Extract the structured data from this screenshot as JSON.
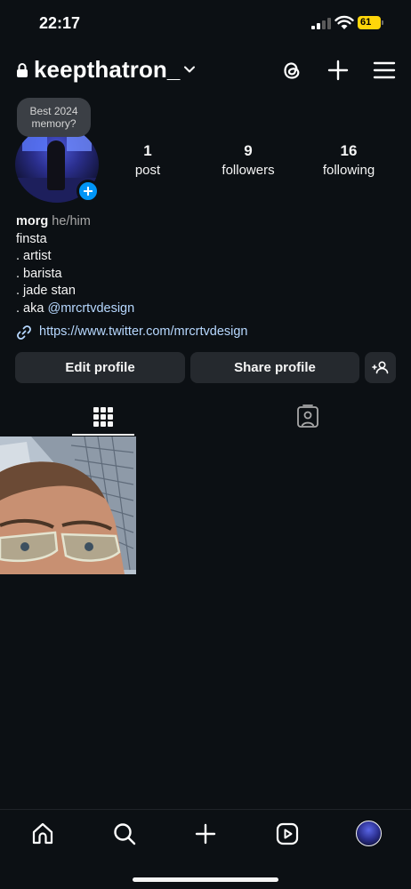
{
  "status_bar": {
    "time": "22:17",
    "battery_level": "61",
    "battery_color": "#ffd60a"
  },
  "header": {
    "username": "keepthatron_",
    "icons": [
      "lock-icon",
      "chevron-down-icon",
      "threads-icon",
      "plus-icon",
      "menu-icon"
    ]
  },
  "profile": {
    "memory_prompt": "Best 2024 memory?",
    "stats": [
      {
        "value": "1",
        "label": "post"
      },
      {
        "value": "9",
        "label": "followers"
      },
      {
        "value": "16",
        "label": "following"
      }
    ],
    "name": "morg",
    "pronouns": "he/him",
    "bio_lines": [
      "finsta",
      ". artist",
      ". barista",
      ". jade stan"
    ],
    "aka_prefix": ". aka ",
    "aka_mention": "@mrcrtvdesign",
    "link": "https://www.twitter.com/mrcrtvdesign"
  },
  "actions": {
    "edit_profile": "Edit profile",
    "share_profile": "Share profile"
  },
  "tabs": [
    "grid-icon",
    "tagged-icon"
  ],
  "bottom_nav": [
    "home-icon",
    "search-icon",
    "create-icon",
    "reels-icon",
    "profile-avatar"
  ],
  "colors": {
    "background": "#0c1014",
    "button": "#25292e",
    "link": "#b7d8ff",
    "accent": "#0095f6"
  }
}
